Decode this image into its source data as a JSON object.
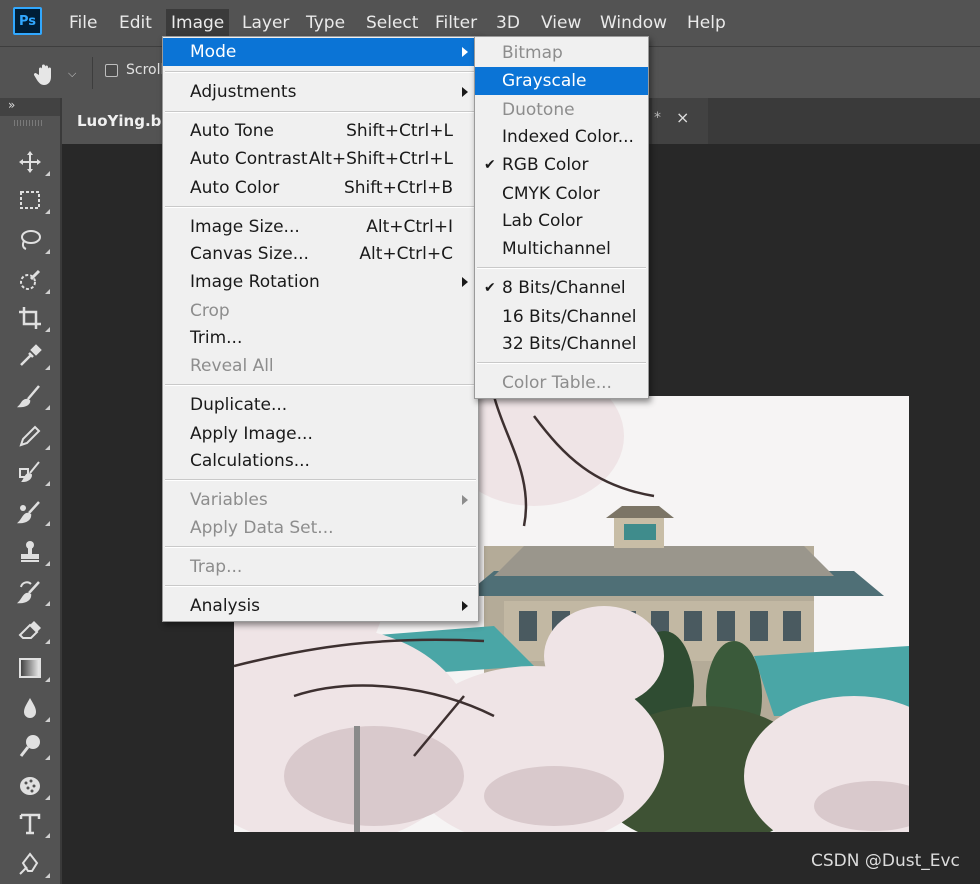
{
  "app": {
    "logo_text": "Ps"
  },
  "menubar": {
    "items": [
      "File",
      "Edit",
      "Image",
      "Layer",
      "Type",
      "Select",
      "Filter",
      "3D",
      "View",
      "Window",
      "Help"
    ]
  },
  "options_bar": {
    "scroll_label": "Scroll"
  },
  "toolbar": {
    "collapse_label": "»"
  },
  "tabs": {
    "doc_title": "LuoYing.bm",
    "tab2_mark": "*",
    "close_glyph": "×"
  },
  "image_menu": {
    "mode": "Mode",
    "adjustments": "Adjustments",
    "auto_tone": {
      "label": "Auto Tone",
      "shortcut": "Shift+Ctrl+L"
    },
    "auto_contrast": {
      "label": "Auto Contrast",
      "shortcut": "Alt+Shift+Ctrl+L"
    },
    "auto_color": {
      "label": "Auto Color",
      "shortcut": "Shift+Ctrl+B"
    },
    "image_size": {
      "label": "Image Size...",
      "shortcut": "Alt+Ctrl+I"
    },
    "canvas_size": {
      "label": "Canvas Size...",
      "shortcut": "Alt+Ctrl+C"
    },
    "image_rotation": "Image Rotation",
    "crop": "Crop",
    "trim": "Trim...",
    "reveal_all": "Reveal All",
    "duplicate": "Duplicate...",
    "apply_image": "Apply Image...",
    "calculations": "Calculations...",
    "variables": "Variables",
    "apply_data_set": "Apply Data Set...",
    "trap": "Trap...",
    "analysis": "Analysis"
  },
  "mode_submenu": {
    "bitmap": "Bitmap",
    "grayscale": "Grayscale",
    "duotone": "Duotone",
    "indexed_color": "Indexed Color...",
    "rgb_color": "RGB Color",
    "cmyk_color": "CMYK Color",
    "lab_color": "Lab Color",
    "multichannel": "Multichannel",
    "bits8": "8 Bits/Channel",
    "bits16": "16 Bits/Channel",
    "bits32": "32 Bits/Channel",
    "color_table": "Color Table...",
    "check_glyph": "✔"
  },
  "watermark": "CSDN @Dust_Evc",
  "colors": {
    "menubar": "#535353",
    "workspace": "#282828",
    "menu_bg": "#f0f0f0",
    "highlight": "#0b74d6",
    "brand": "#31a8ff"
  }
}
